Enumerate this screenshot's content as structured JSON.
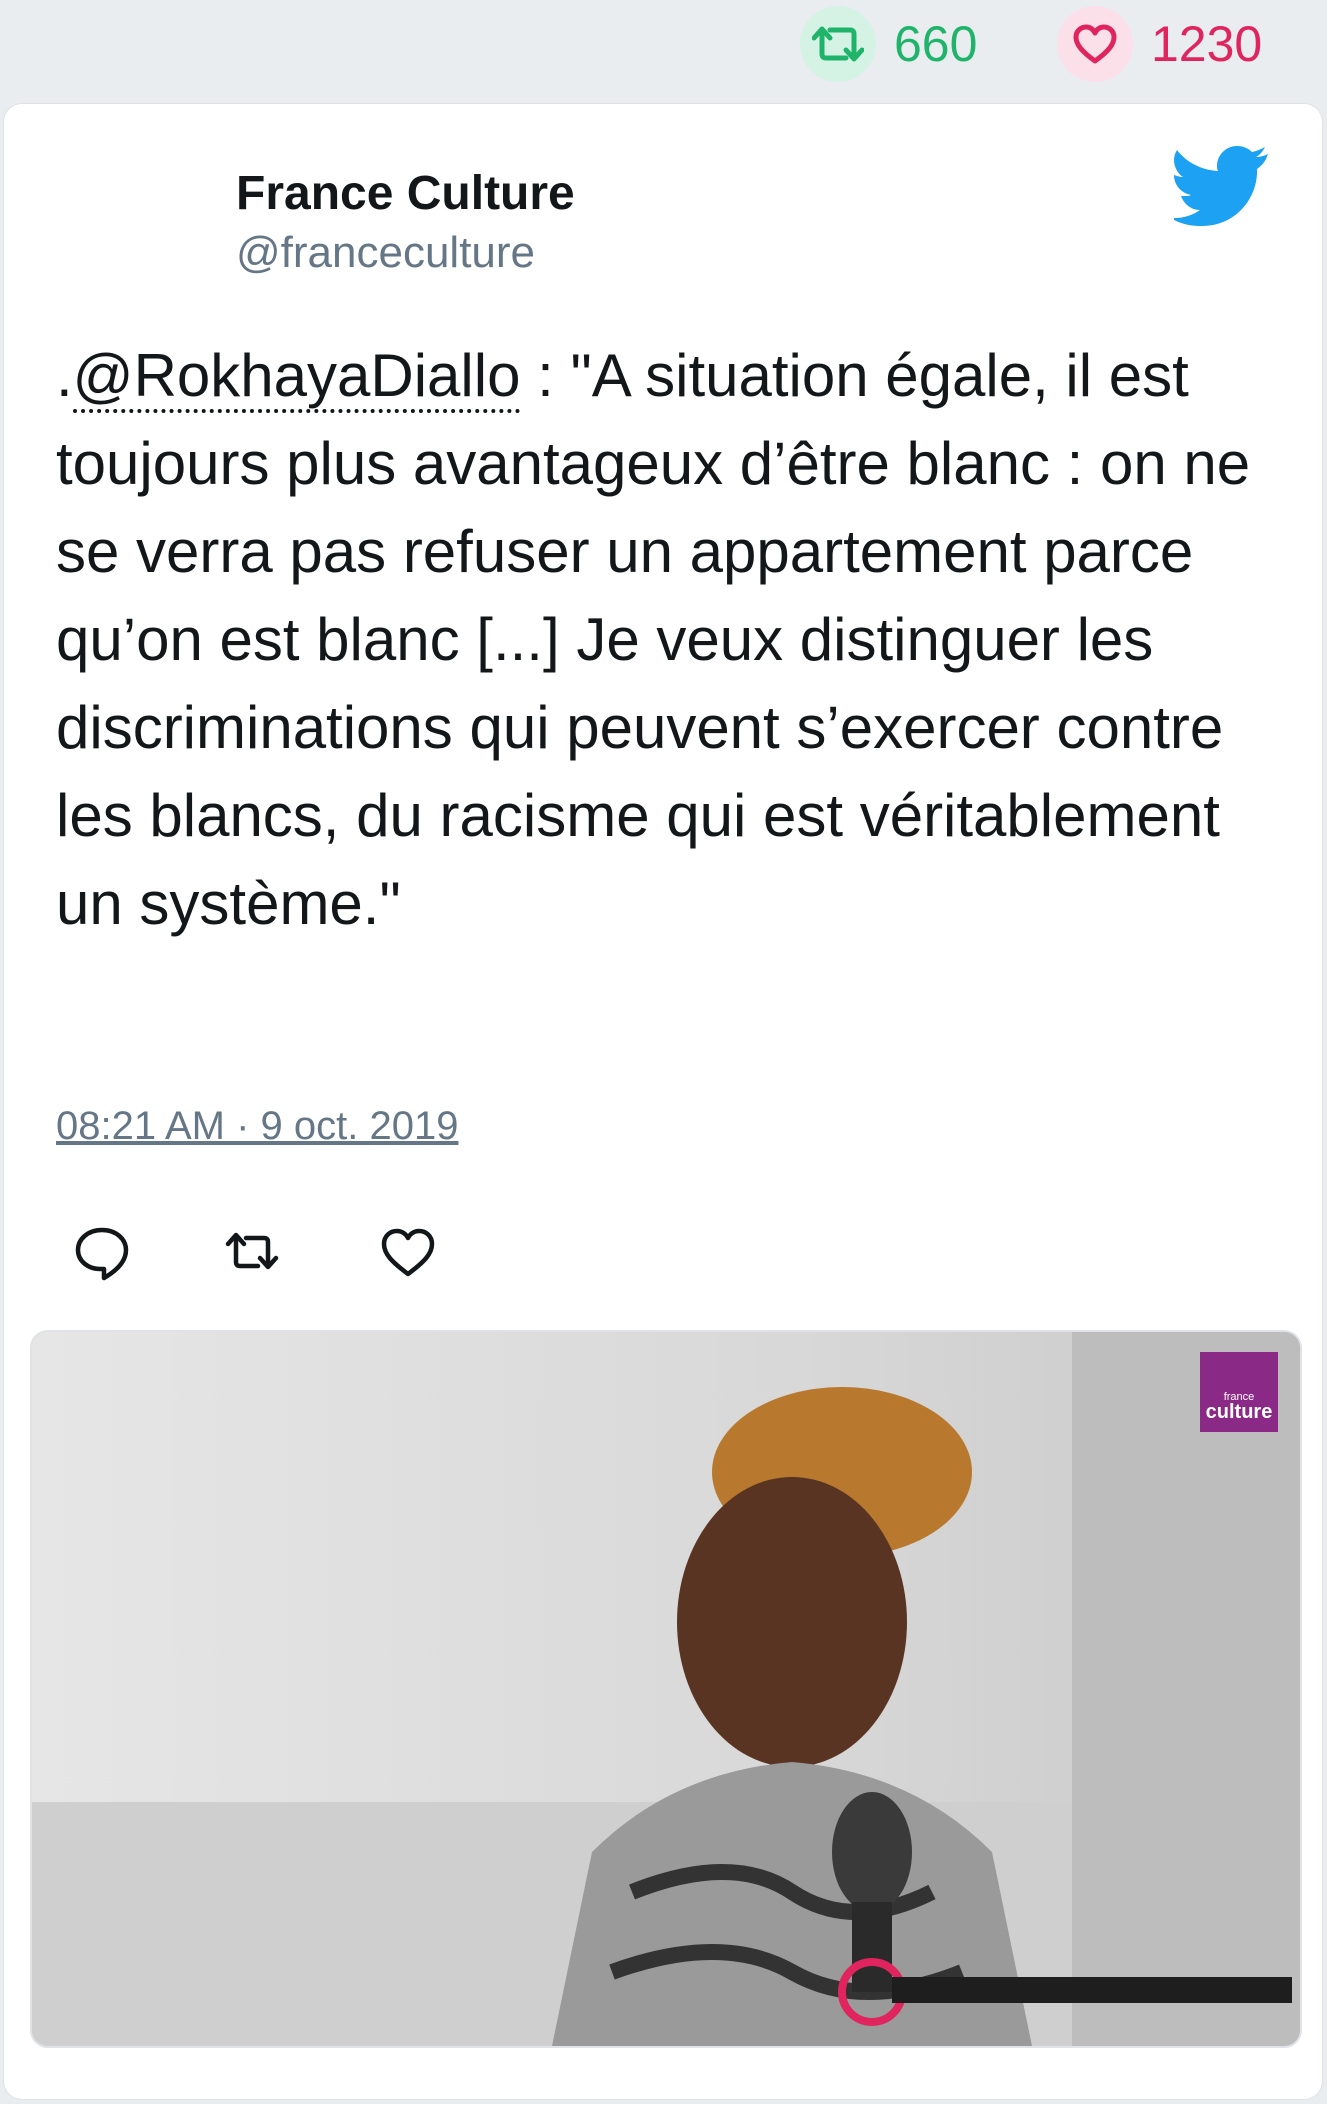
{
  "stats": {
    "retweet_count": "660",
    "like_count": "1230"
  },
  "tweet": {
    "author_name": "France Culture",
    "author_handle": "@franceculture",
    "text_prefix": ".",
    "mention": "@RokhayaDiallo",
    "text_body": " : \"A situation égale, il est toujours plus avantageux d’être blanc : on ne se verra pas refuser un appartement parce qu’on est blanc [...] Je veux distinguer les discriminations qui peuvent s’exercer contre les blancs, du racisme qui est véritablement un système.\"",
    "timestamp": "08:21 AM · 9 oct. 2019"
  },
  "media": {
    "channel_badge_top": "france",
    "channel_badge_main": "culture"
  },
  "icons": {
    "retweet": "retweet-icon",
    "like": "heart-icon",
    "reply": "reply-icon",
    "brand": "twitter-bird-icon"
  },
  "colors": {
    "retweet": "#20b46a",
    "like": "#e0245e",
    "twitter_blue": "#1da1f2",
    "channel_purple": "#8a2a86"
  }
}
